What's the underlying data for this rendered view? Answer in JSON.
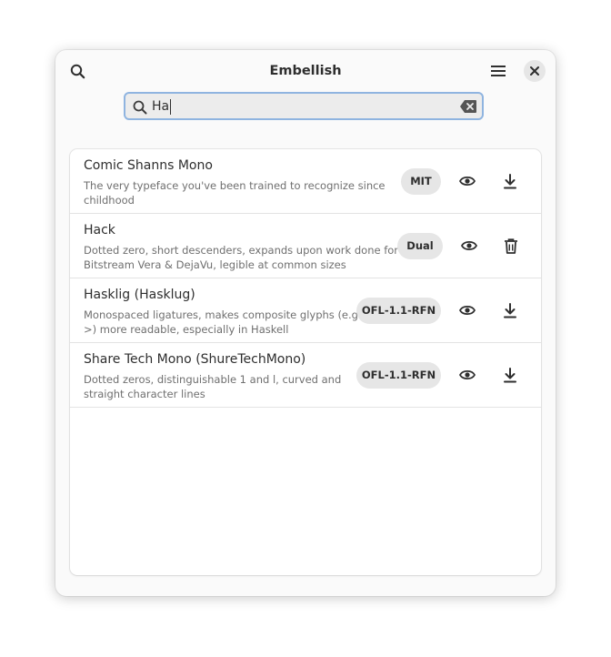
{
  "window": {
    "title": "Embellish"
  },
  "headerbar": {
    "search_icon": "search-icon",
    "menu_icon": "hamburger-menu-icon",
    "close_icon": "close-icon"
  },
  "search": {
    "value": "Ha",
    "icon": "search-icon",
    "clear_icon": "clear-text-icon"
  },
  "colors": {
    "accent_border": "#8fb4e0",
    "badge_bg": "#e6e6e6",
    "text_primary": "#2e2e2e",
    "text_secondary": "#6f6f6f"
  },
  "fonts": [
    {
      "name": "Comic Shanns Mono",
      "desc_line1": "The very typeface you've been trained to recognize since",
      "desc_line2": "childhood",
      "license": "MIT",
      "preview_icon": "eye-icon",
      "action_icon": "download-icon"
    },
    {
      "name": "Hack",
      "desc_line1": "Dotted zero, short descenders, expands upon work done for",
      "desc_line2": "Bitstream Vera & DejaVu, legible at common sizes",
      "license": "Dual",
      "preview_icon": "eye-icon",
      "action_icon": "trash-icon"
    },
    {
      "name": "Hasklig (Hasklug)",
      "desc_line1": "Monospaced ligatures, makes composite glyphs (e.g. -",
      "desc_line2": ">) more readable, especially in Haskell",
      "license": "OFL-1.1-RFN",
      "preview_icon": "eye-icon",
      "action_icon": "download-icon"
    },
    {
      "name": "Share Tech Mono (ShureTechMono)",
      "desc_line1": "Dotted zeros, distinguishable 1 and l, curved and",
      "desc_line2": "straight character lines",
      "license": "OFL-1.1-RFN",
      "preview_icon": "eye-icon",
      "action_icon": "download-icon"
    }
  ]
}
